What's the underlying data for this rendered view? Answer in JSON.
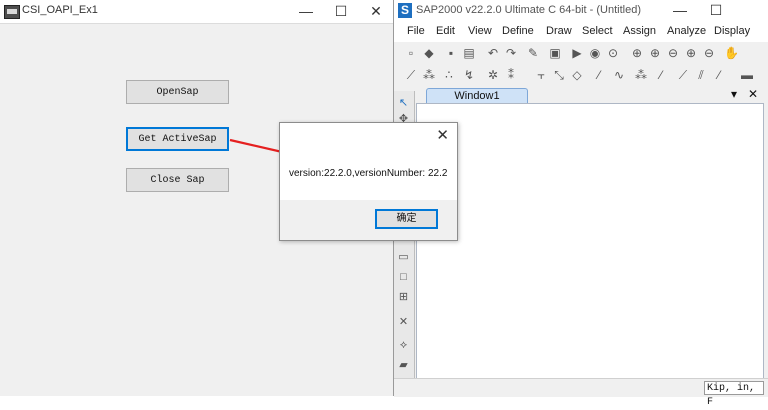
{
  "app": {
    "title": "CSI_OAPI_Ex1",
    "window_controls": {
      "minimize": "—",
      "maximize": "☐",
      "close": "✕"
    },
    "buttons": {
      "open": "OpenSap",
      "get_active": "Get ActiveSap",
      "close": "Close Sap"
    }
  },
  "sap": {
    "logo": "S",
    "title": "SAP2000 v22.2.0 Ultimate C 64-bit - (Untitled)",
    "window_controls": {
      "minimize": "—",
      "maximize": "☐"
    },
    "menu": [
      "File",
      "Edit",
      "View",
      "Define",
      "Draw",
      "Select",
      "Assign",
      "Analyze",
      "Display"
    ],
    "tab_label": "Window1",
    "units": "Kip, in, F"
  },
  "dialog": {
    "close": "✕",
    "message": "version:22.2.0,versionNumber: 22.2",
    "ok_label": "确定"
  },
  "colors": {
    "accent": "#0078d7",
    "arrow": "#e52020",
    "tab": "#cfe2f7"
  }
}
